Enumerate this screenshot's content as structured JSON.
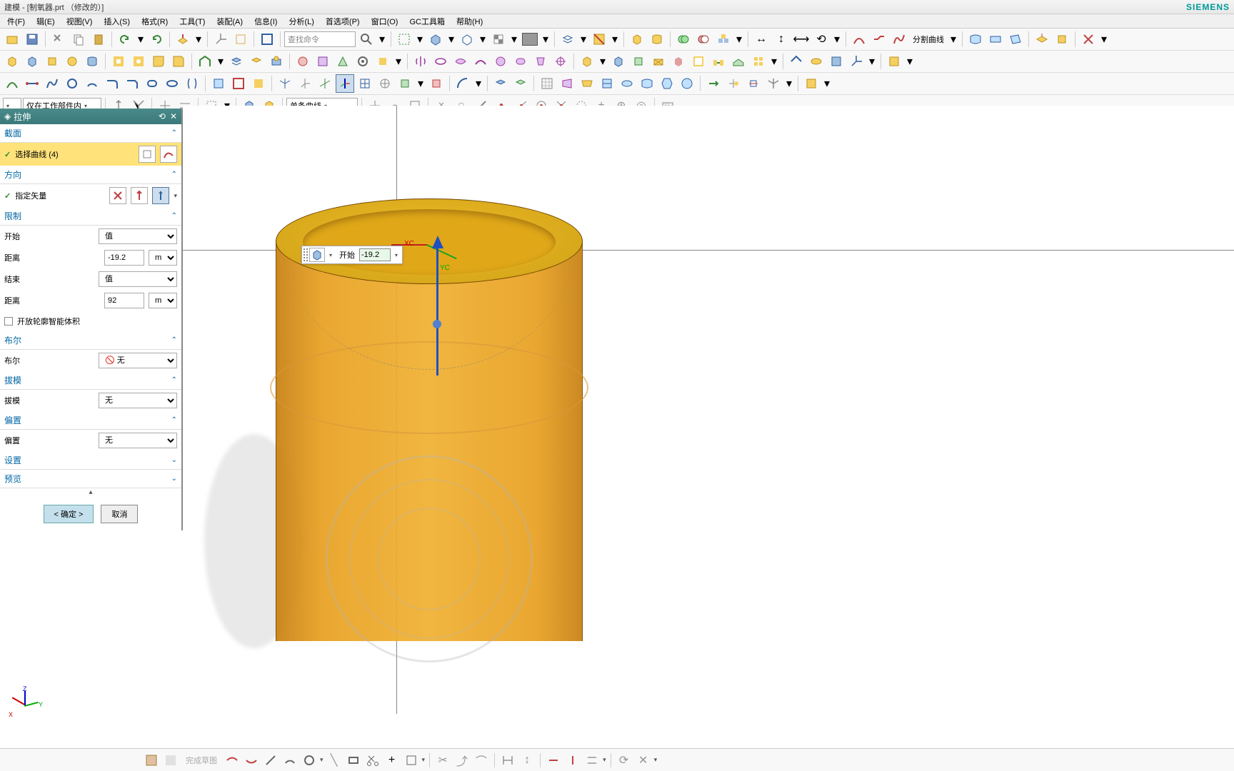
{
  "window": {
    "title": "建模 - [制氧器.prt （修改的）]",
    "brand": "SIEMENS"
  },
  "menu": {
    "file": "件(F)",
    "edit": "辑(E)",
    "view": "视图(V)",
    "insert": "插入(S)",
    "format": "格式(R)",
    "tools": "工具(T)",
    "assemblies": "装配(A)",
    "info": "信息(I)",
    "analysis": "分析(L)",
    "preferences": "首选项(P)",
    "window": "窗口(O)",
    "gc": "GC工具箱",
    "help": "帮助(H)"
  },
  "toolbar1": {
    "search_placeholder": "查找命令",
    "split_label": "分割曲线"
  },
  "toolbar3": {
    "scope": "仅在工作部件内",
    "curve_mode": "单条曲线"
  },
  "dialog": {
    "title": "拉伸",
    "section": {
      "hdr": "截面",
      "select_curve": "选择曲线 (4)"
    },
    "direction": {
      "hdr": "方向",
      "specify_vector": "指定矢量"
    },
    "limits": {
      "hdr": "限制",
      "start": "开始",
      "start_type": "值",
      "start_dist_label": "距离",
      "start_dist": "-19.2",
      "end": "结束",
      "end_type": "值",
      "end_dist_label": "距离",
      "end_dist": "92",
      "unit": "mm",
      "open_smart": "开放轮廓智能体积"
    },
    "boolean": {
      "hdr": "布尔",
      "lbl": "布尔",
      "value": "无"
    },
    "draft": {
      "hdr": "拔模",
      "lbl": "拔模",
      "value": "无"
    },
    "offset": {
      "hdr": "偏置",
      "lbl": "偏置",
      "value": "无"
    },
    "settings": {
      "hdr": "设置"
    },
    "preview": {
      "hdr": "预览"
    },
    "ok": "< 确定 >",
    "cancel": "取消"
  },
  "floatbar": {
    "label": "开始",
    "value": "-19.2"
  },
  "viewport": {
    "xc": "XC",
    "yc": "YC"
  },
  "bottombar": {
    "sketch_state": "完成草图"
  },
  "triad": {
    "x": "X",
    "y": "Y",
    "z": "Z"
  }
}
